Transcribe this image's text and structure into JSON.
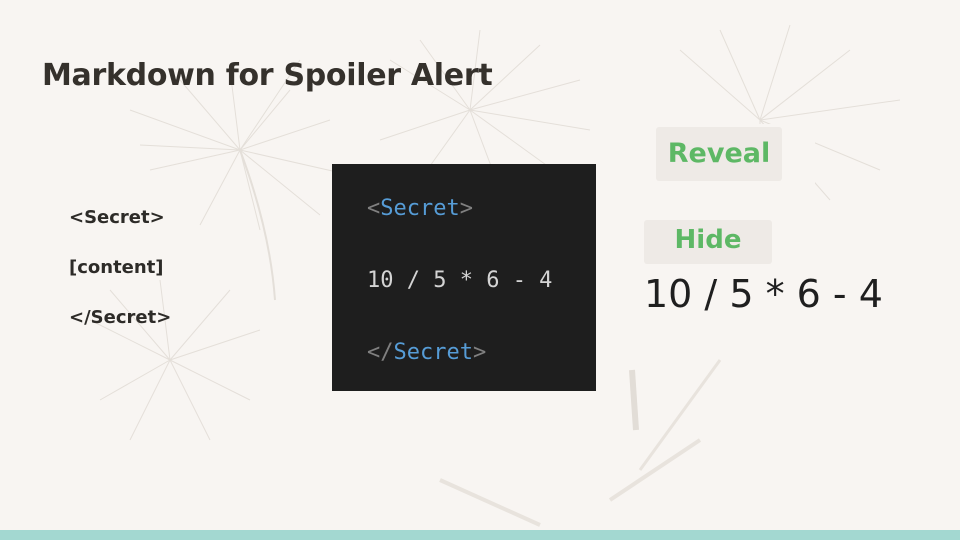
{
  "slide": {
    "title": "Markdown for Spoiler Alert",
    "syntax_lines": [
      "<Secret>",
      "[content]",
      "</Secret>"
    ]
  },
  "code_block": {
    "open_bracket": "<",
    "open_tag": "Secret",
    "open_close_bracket": ">",
    "content": "10 / 5 * 6 - 4",
    "close_bracket": "</",
    "close_tag": "Secret",
    "close_close_bracket": ">"
  },
  "demo": {
    "reveal_label": "Reveal",
    "hide_label": "Hide",
    "revealed_content": "10 / 5 * 6 - 4"
  },
  "colors": {
    "background": "#f8f5f2",
    "code_background": "#1e1e1e",
    "tag_color": "#569cd6",
    "button_text": "#5db865",
    "footer_bar": "#a3d8d1"
  },
  "decor": {
    "background_icon": "dandelion-seed-illustration"
  }
}
